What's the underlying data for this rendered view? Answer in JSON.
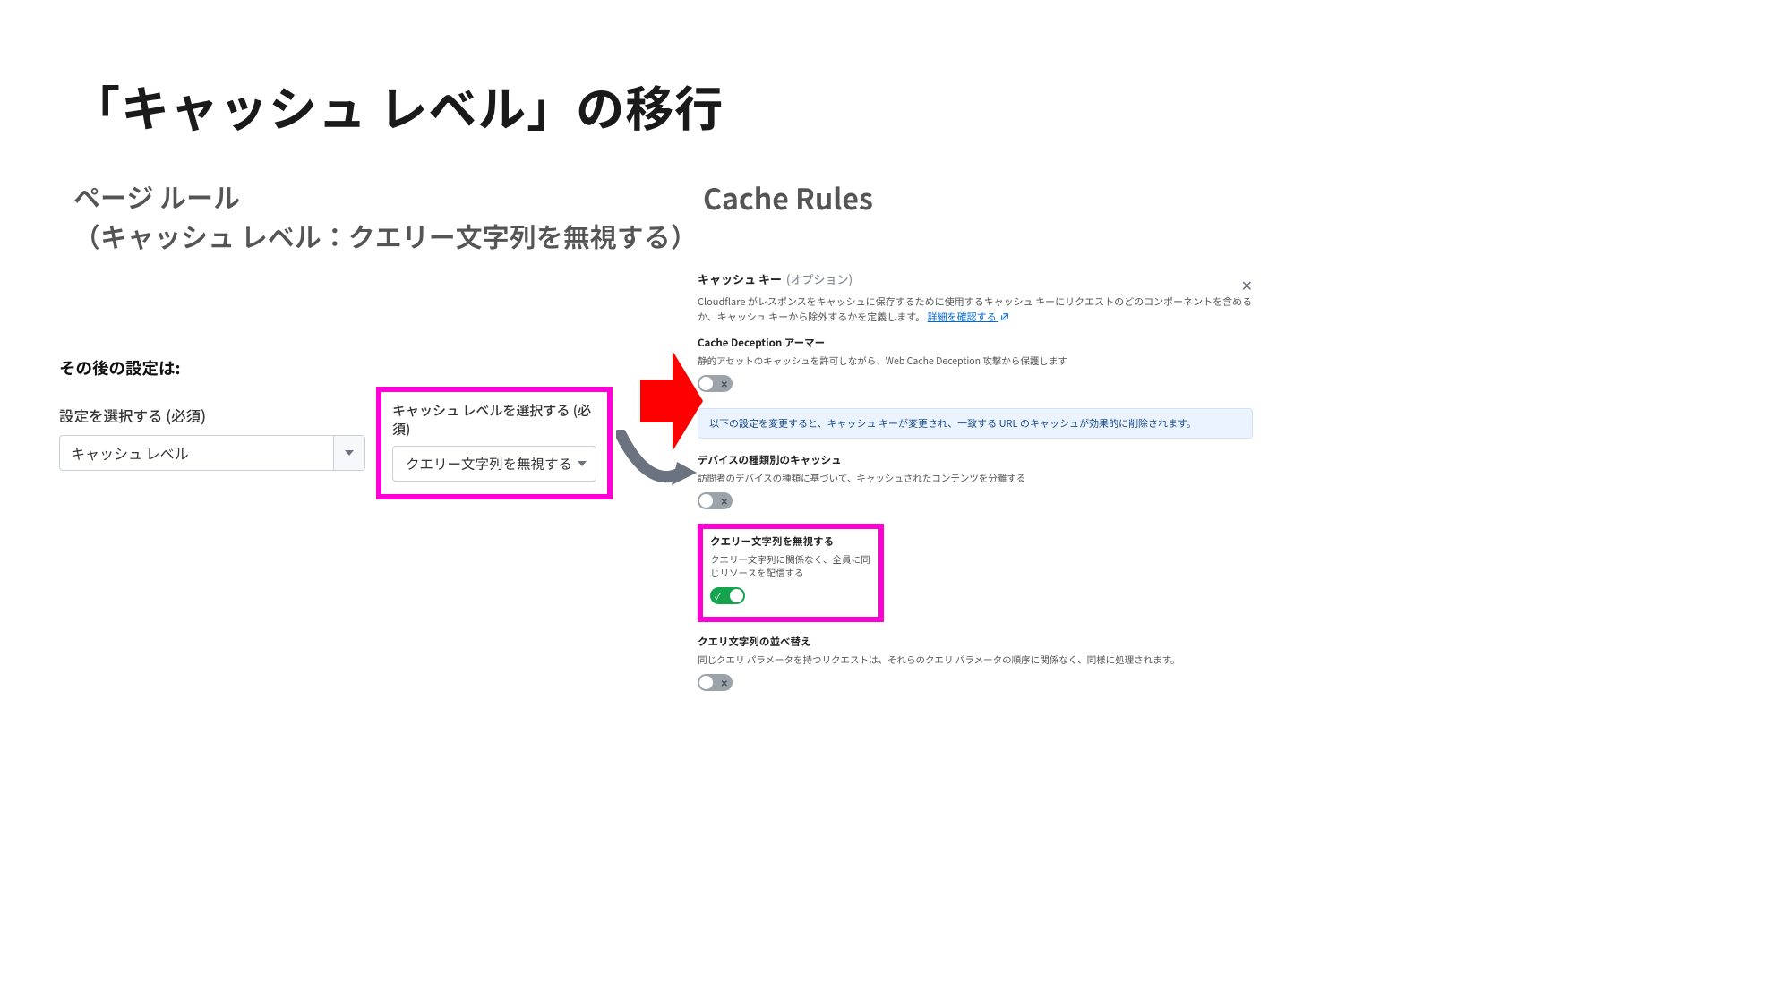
{
  "title": "「キャッシュ レベル」の移行",
  "left": {
    "subtitle_line1": "ページ ルール",
    "subtitle_line2": "（キャッシュ レベル：クエリー文字列を無視する）",
    "after_label": "その後の設定は:",
    "select_label": "設定を選択する (必須)",
    "select_value": "キャッシュ レベル",
    "hl_label": "キャッシュ レベルを選択する (必須)",
    "hl_value": "クエリー文字列を無視する"
  },
  "right": {
    "subtitle": "Cache Rules",
    "section_title": "キャッシュ キー",
    "section_optional": "(オプション)",
    "section_desc_1": "Cloudflare がレスポンスをキャッシュに保存するために使用するキャッシュ キーにリクエストのどのコンポーネントを含めるか、キャッシュ キーから除外するかを定義します。",
    "section_link": "詳細を確認する",
    "cd_title": "Cache Deception アーマー",
    "cd_desc": "静的アセットのキャッシュを許可しながら、Web Cache Deception 攻撃から保護します",
    "banner": "以下の設定を変更すると、キャッシュ キーが変更され、一致する URL のキャッシュが効果的に削除されます。",
    "device_title": "デバイスの種類別のキャッシュ",
    "device_desc": "訪問者のデバイスの種類に基づいて、キャッシュされたコンテンツを分離する",
    "ignore_title": "クエリー文字列を無視する",
    "ignore_desc": "クエリー文字列に関係なく、全員に同じリソースを配信する",
    "sort_title": "クエリ文字列の並べ替え",
    "sort_desc": "同じクエリ パラメータを持つリクエストは、それらのクエリ パラメータの順序に関係なく、同様に処理されます。"
  },
  "colors": {
    "highlight": "#ff00d4",
    "arrow": "#ff0000",
    "link": "#0068d6",
    "banner_bg": "#eaf3fe",
    "toggle_on": "#14a44d"
  },
  "chart_data": null
}
